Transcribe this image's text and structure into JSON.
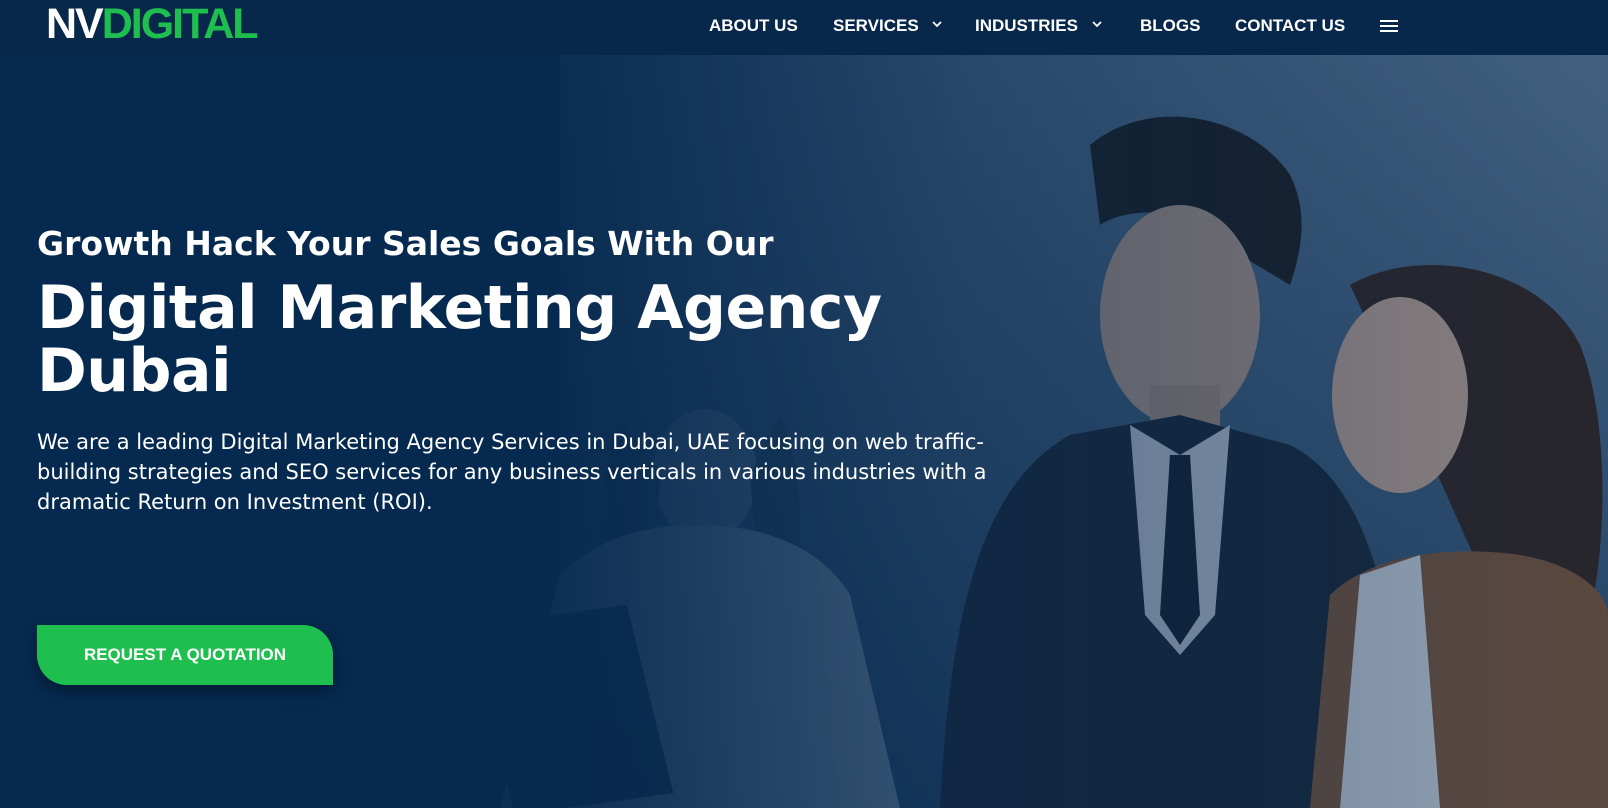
{
  "brand": {
    "logo_part1": "NV",
    "logo_part2": "DIGITAL",
    "logo_color_primary": "#ffffff",
    "logo_color_accent": "#1fbf4f"
  },
  "nav": {
    "items": [
      {
        "label": "ABOUT US",
        "has_dropdown": false
      },
      {
        "label": "SERVICES",
        "has_dropdown": true
      },
      {
        "label": "INDUSTRIES",
        "has_dropdown": true
      },
      {
        "label": "BLOGS",
        "has_dropdown": false
      },
      {
        "label": "CONTACT US",
        "has_dropdown": false
      }
    ],
    "menu_icon": "hamburger-menu-icon"
  },
  "hero": {
    "subtitle": "Growth Hack Your Sales Goals With Our",
    "title": "Digital Marketing Agency Dubai",
    "description": "We are a leading Digital Marketing Agency Services in Dubai, UAE focusing on web traffic-building strategies and SEO services for any business verticals in various industries with a dramatic Return on Investment (ROI).",
    "cta_label": "REQUEST A QUOTATION"
  },
  "colors": {
    "header_bg": "#07284a",
    "hero_overlay": "#05294e",
    "accent_green": "#1fbf4f",
    "text": "#ffffff"
  }
}
